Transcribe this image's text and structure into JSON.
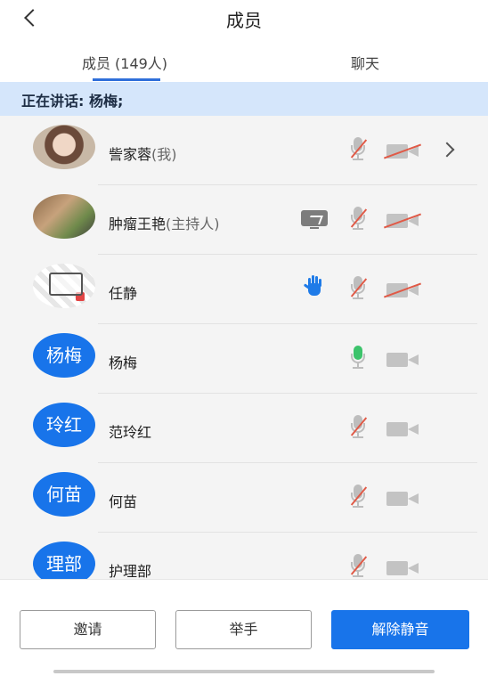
{
  "header": {
    "title": "成员"
  },
  "tabs": [
    {
      "label": "成员 (149人)",
      "selected": true
    },
    {
      "label": "聊天",
      "selected": false
    }
  ],
  "speaking": {
    "text": "正在讲话: 杨梅;"
  },
  "members": [
    {
      "name": "訾家蓉",
      "suffix": "(我)",
      "avatar_type": "photo",
      "mic": "muted",
      "video": "off",
      "extra": "chevron"
    },
    {
      "name": "肿瘤王艳",
      "suffix": "(主持人)",
      "avatar_type": "photo",
      "mic": "muted",
      "video": "off",
      "extra": "screen-share"
    },
    {
      "name": "任静",
      "suffix": "",
      "avatar_type": "photo",
      "mic": "muted",
      "video": "off",
      "extra": "raised-hand"
    },
    {
      "name": "杨梅",
      "suffix": "",
      "avatar_text": "杨梅",
      "mic": "active",
      "video": "on"
    },
    {
      "name": "范玲红",
      "suffix": "",
      "avatar_text": "玲红",
      "mic": "muted",
      "video": "on"
    },
    {
      "name": "何苗",
      "suffix": "",
      "avatar_text": "何苗",
      "mic": "muted",
      "video": "on"
    },
    {
      "name": "护理部",
      "suffix": "",
      "avatar_text": "理部",
      "mic": "muted",
      "video": "on"
    }
  ],
  "bottom": {
    "invite_label": "邀请",
    "raise_hand_label": "举手",
    "unmute_label": "解除静音"
  },
  "colors": {
    "accent": "#1874ea",
    "speaking_bg": "#d5e6fb",
    "muted_slash": "#e05a47",
    "mic_active": "#3cc36b"
  }
}
